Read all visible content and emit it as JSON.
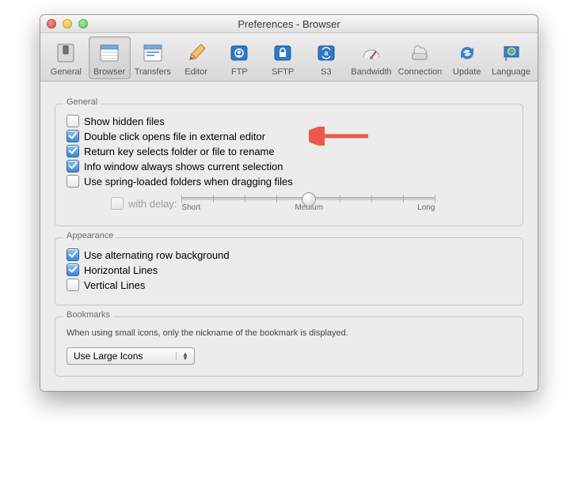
{
  "window": {
    "title": "Preferences - Browser"
  },
  "toolbar": {
    "selected": "Browser",
    "items": [
      {
        "id": "general",
        "label": "General"
      },
      {
        "id": "browser",
        "label": "Browser"
      },
      {
        "id": "transfers",
        "label": "Transfers"
      },
      {
        "id": "editor",
        "label": "Editor"
      },
      {
        "id": "ftp",
        "label": "FTP"
      },
      {
        "id": "sftp",
        "label": "SFTP"
      },
      {
        "id": "s3",
        "label": "S3"
      },
      {
        "id": "bandwidth",
        "label": "Bandwidth"
      },
      {
        "id": "connection",
        "label": "Connection"
      },
      {
        "id": "update",
        "label": "Update"
      },
      {
        "id": "language",
        "label": "Language"
      }
    ]
  },
  "groups": {
    "general": {
      "title": "General",
      "options": [
        {
          "id": "hidden",
          "label": "Show hidden files",
          "checked": false
        },
        {
          "id": "dblclick",
          "label": "Double click opens file in external editor",
          "checked": true
        },
        {
          "id": "return",
          "label": "Return key selects folder or file to rename",
          "checked": true
        },
        {
          "id": "info",
          "label": "Info window always shows current selection",
          "checked": true
        },
        {
          "id": "spring",
          "label": "Use spring-loaded folders when dragging files",
          "checked": false
        }
      ],
      "delay": {
        "label": "with delay:",
        "checked": false,
        "enabled": false,
        "min_label": "Short",
        "mid_label": "Medium",
        "max_label": "Long",
        "value": 50
      }
    },
    "appearance": {
      "title": "Appearance",
      "options": [
        {
          "id": "altrow",
          "label": "Use alternating row background",
          "checked": true
        },
        {
          "id": "hlines",
          "label": "Horizontal Lines",
          "checked": true
        },
        {
          "id": "vlines",
          "label": "Vertical Lines",
          "checked": false
        }
      ]
    },
    "bookmarks": {
      "title": "Bookmarks",
      "note": "When using small icons, only the nickname of the bookmark is displayed.",
      "select": {
        "value": "Use Large Icons"
      }
    }
  }
}
